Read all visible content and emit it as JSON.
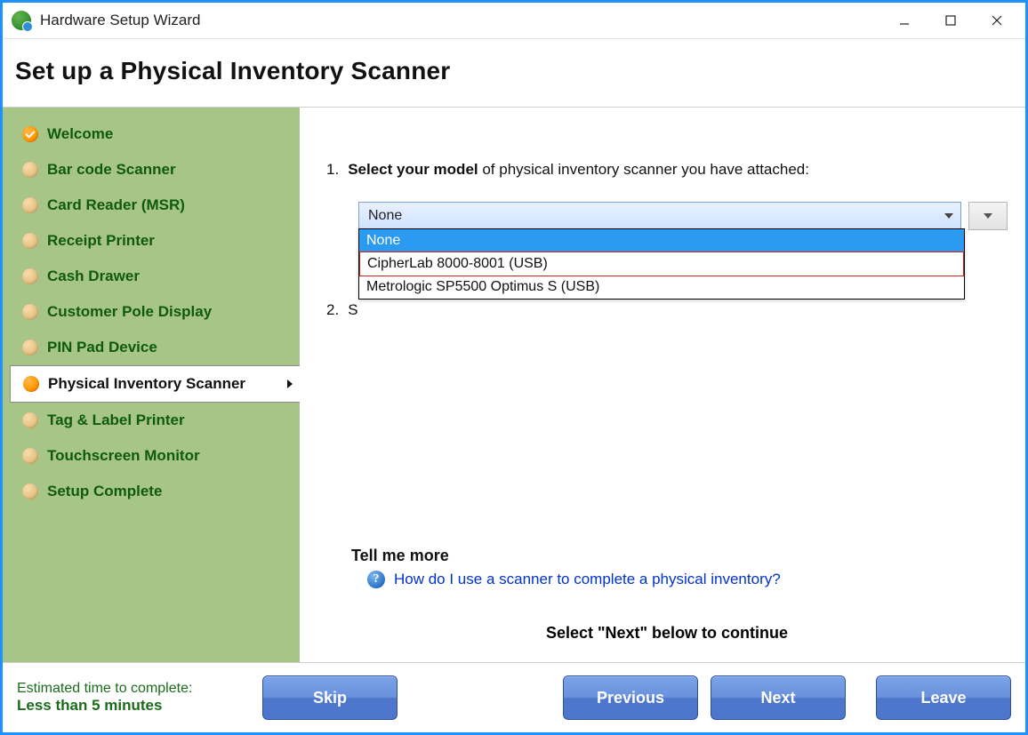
{
  "window": {
    "title": "Hardware Setup Wizard"
  },
  "page_title": "Set up a Physical Inventory Scanner",
  "sidebar": {
    "items": [
      {
        "label": "Welcome",
        "state": "done"
      },
      {
        "label": "Bar code Scanner",
        "state": "pending"
      },
      {
        "label": "Card Reader (MSR)",
        "state": "pending"
      },
      {
        "label": "Receipt Printer",
        "state": "pending"
      },
      {
        "label": "Cash Drawer",
        "state": "pending"
      },
      {
        "label": "Customer Pole Display",
        "state": "pending"
      },
      {
        "label": "PIN Pad Device",
        "state": "pending"
      },
      {
        "label": "Physical Inventory Scanner",
        "state": "active"
      },
      {
        "label": "Tag & Label Printer",
        "state": "pending"
      },
      {
        "label": "Touchscreen Monitor",
        "state": "pending"
      },
      {
        "label": "Setup Complete",
        "state": "pending"
      }
    ]
  },
  "steps": {
    "step1_num": "1.",
    "step1_bold": "Select your model",
    "step1_rest": " of physical inventory scanner you have attached:",
    "step2_num": "2.",
    "step2_prefix": "S"
  },
  "dropdown": {
    "selected": "None",
    "options": [
      "None",
      "CipherLab 8000-8001 (USB)",
      "Metrologic SP5500 Optimus S (USB)"
    ],
    "highlighted_index": 0,
    "outlined_index": 1
  },
  "help": {
    "heading": "Tell me more",
    "link_text": "How do I use a scanner to complete a physical inventory?"
  },
  "continue_hint": "Select \"Next\" below to continue",
  "footer": {
    "est_label": "Estimated time to complete:",
    "est_value": "Less than 5 minutes",
    "skip": "Skip",
    "previous": "Previous",
    "next": "Next",
    "leave": "Leave"
  }
}
